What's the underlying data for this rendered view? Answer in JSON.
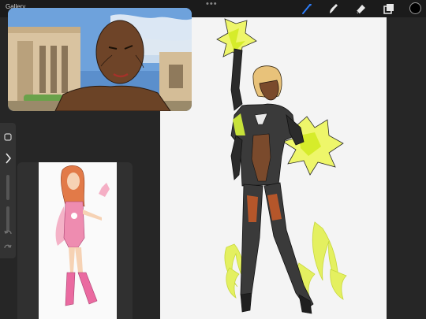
{
  "app": {
    "gallery_label": "Gallery",
    "handle_icon": "more-dots-icon"
  },
  "tools": [
    {
      "name": "brush-icon",
      "active": true
    },
    {
      "name": "smudge-icon",
      "active": false
    },
    {
      "name": "eraser-icon",
      "active": false
    },
    {
      "name": "layers-icon",
      "active": false
    }
  ],
  "current_color": "#000000",
  "accent_color": "#2d7cf6",
  "reference_windows": [
    {
      "name": "reference-window-villain-portrait"
    },
    {
      "name": "reference-window-pink-heroine"
    }
  ],
  "canvas": {
    "background": "#f4f4f4"
  }
}
